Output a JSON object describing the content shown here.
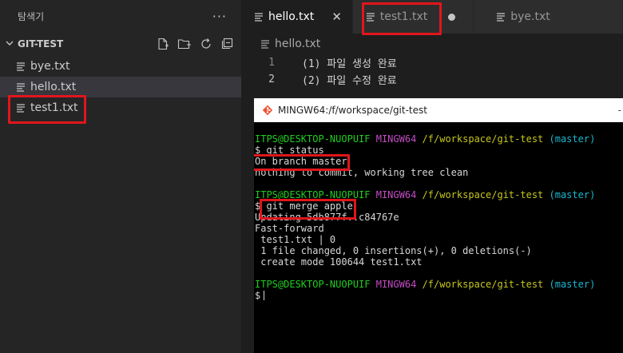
{
  "sidebar": {
    "title": "탐색기",
    "more_label": "···",
    "folder": "GIT-TEST",
    "files": [
      {
        "name": "bye.txt"
      },
      {
        "name": "hello.txt"
      },
      {
        "name": "test1.txt"
      }
    ]
  },
  "tabs": [
    {
      "label": "hello.txt"
    },
    {
      "label": "test1.txt"
    },
    {
      "label": "bye.txt"
    }
  ],
  "breadcrumb": "hello.txt",
  "editor_lines": [
    {
      "num": "1",
      "text": "(1) 파일 생성 완료"
    },
    {
      "num": "2",
      "text": "(2) 파일 수정 완료"
    }
  ],
  "terminal": {
    "title": "MINGW64:/f/workspace/git-test",
    "prompt_user": "ITPS@DESKTOP-NUOPUIF",
    "prompt_env": "MINGW64",
    "prompt_path": "/f/workspace/git-test",
    "prompt_branch": "(master)",
    "cmd1": "$ git status",
    "out1a": "On branch master",
    "out1b": "nothing to commit, working tree clean",
    "cmd2": "$ git merge apple",
    "out2a": "Updating 5db877f..c84767e",
    "out2b": "Fast-forward",
    "out2c": " test1.txt | 0",
    "out2d": " 1 file changed, 0 insertions(+), 0 deletions(-)",
    "out2e": " create mode 100644 test1.txt",
    "cmd3": "$"
  },
  "colors": {
    "highlight": "#e0161c",
    "prompt_user": "#1fcf1f",
    "prompt_env": "#c34dc3",
    "prompt_path": "#c6c61b",
    "prompt_branch": "#1ab7cf"
  }
}
